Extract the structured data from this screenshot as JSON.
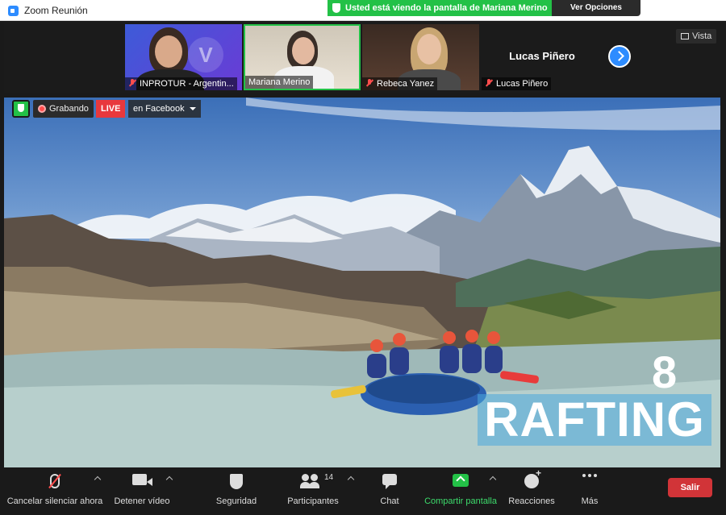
{
  "window": {
    "title": "Zoom Reunión",
    "share_banner": "Usted está viendo la pantalla de Mariana Merino",
    "view_options": "Ver Opciones"
  },
  "gallery": {
    "participants": [
      {
        "name": "INPROTUR - Argentin..."
      },
      {
        "name": "Mariana Merino"
      },
      {
        "name": "Rebeca Yanez"
      },
      {
        "name": "Lucas Piñero"
      }
    ],
    "big_name": "Lucas Piñero",
    "view_button": "Vista"
  },
  "recording": {
    "label": "Grabando",
    "live": "LIVE",
    "destination": "en Facebook"
  },
  "shared_content": {
    "number": "8",
    "title": "RAFTING"
  },
  "toolbar": {
    "mute": "Cancelar silenciar ahora",
    "video": "Detener vídeo",
    "security": "Seguridad",
    "participants": "Participantes",
    "participants_count": "14",
    "chat": "Chat",
    "share": "Compartir pantalla",
    "reactions": "Reacciones",
    "more": "Más",
    "leave": "Salir"
  },
  "colors": {
    "accent_green": "#23c147",
    "leave_red": "#d13438",
    "live_red": "#e8383d",
    "zoom_blue": "#2d8cff"
  }
}
